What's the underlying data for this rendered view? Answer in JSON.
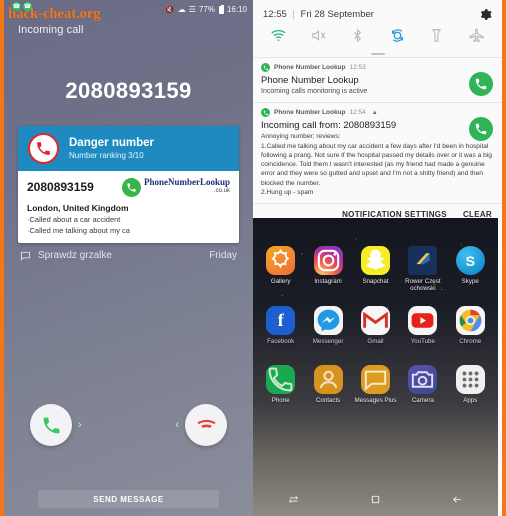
{
  "left": {
    "watermark": "hack-cheat.org",
    "statusbar": {
      "battery": "77%",
      "time": "16:10",
      "icons": [
        "mute-icon",
        "signal-icon",
        "wifi-signal-icon",
        "battery-icon"
      ]
    },
    "incoming_label": "Incoming call",
    "caller_number": "2080893159",
    "card": {
      "title": "Danger number",
      "subtitle": "Number ranking 3/10",
      "number": "2080893159",
      "brand_line1": "PhoneNumberLookup",
      "brand_line1_accent": "Lookup",
      "brand_line2": ".co.uk",
      "location": "London, United Kingdom",
      "review_1": "·Called about a car accident",
      "review_2": "·Called me talking about my ca"
    },
    "snooze": {
      "label": "Sprawdz grzalke",
      "day": "Friday"
    },
    "actions": {
      "answer": "answer-call",
      "decline": "decline-call",
      "send_message": "SEND MESSAGE"
    }
  },
  "right": {
    "quick_settings": {
      "time": "12:55",
      "date": "Fri 28 September",
      "gear": "settings-gear-icon",
      "toggles": [
        {
          "name": "wifi-toggle",
          "active": true
        },
        {
          "name": "sound-mute-toggle",
          "active": false
        },
        {
          "name": "bluetooth-toggle",
          "active": false
        },
        {
          "name": "auto-rotate-toggle",
          "active": true
        },
        {
          "name": "flashlight-toggle",
          "active": false
        },
        {
          "name": "airplane-mode-toggle",
          "active": false
        }
      ]
    },
    "notifications": [
      {
        "app": "Phone Number Lookup",
        "time": "12:53",
        "title": "Phone Number Lookup",
        "text": "Incoming calls monitoring is active",
        "body": ""
      },
      {
        "app": "Phone Number Lookup",
        "time": "12:54",
        "title": "Incoming call from: 2080893159",
        "text": "Annoying number; reviews:",
        "body": "1.Called me talking about my car accident a few days after I'd been in hospital following a prang. Not sure if the hospital passed my details over or it was a big coincidence. Told them I wasn't interested (as my friend had made a genuine error and they were so gutted and upset and I'm not a shitty friend) and then blocked the number.\n2.Hung up - spam"
      }
    ],
    "footer": {
      "settings": "NOTIFICATION SETTINGS",
      "clear": "CLEAR"
    },
    "home": {
      "row1": [
        {
          "label": "Gallery",
          "icon": "gallery-icon"
        },
        {
          "label": "Instagram",
          "icon": "instagram-icon"
        },
        {
          "label": "Snapchat",
          "icon": "snapchat-icon"
        },
        {
          "label": "Rower Częst ochowski",
          "icon": "rower-czestochowski-icon"
        },
        {
          "label": "Skype",
          "icon": "skype-icon"
        }
      ],
      "row2": [
        {
          "label": "Facebook",
          "icon": "facebook-icon"
        },
        {
          "label": "Messenger",
          "icon": "messenger-icon"
        },
        {
          "label": "Gmail",
          "icon": "gmail-icon"
        },
        {
          "label": "YouTube",
          "icon": "youtube-icon"
        },
        {
          "label": "Chrome",
          "icon": "chrome-icon"
        }
      ],
      "dock": [
        {
          "label": "Phone",
          "icon": "phone-icon"
        },
        {
          "label": "Contacts",
          "icon": "contacts-icon"
        },
        {
          "label": "Messages Plus",
          "icon": "messages-icon"
        },
        {
          "label": "Camera",
          "icon": "camera-icon"
        },
        {
          "label": "Apps",
          "icon": "apps-grid-icon"
        }
      ],
      "navbar": [
        "recents-icon",
        "home-icon",
        "back-icon"
      ]
    }
  },
  "colors": {
    "accent_orange": "#f4761b",
    "card_blue": "#1e8ac0",
    "danger_red": "#e0282c",
    "green": "#2fb457",
    "toggle_active_blue": "#1a9ad6"
  }
}
